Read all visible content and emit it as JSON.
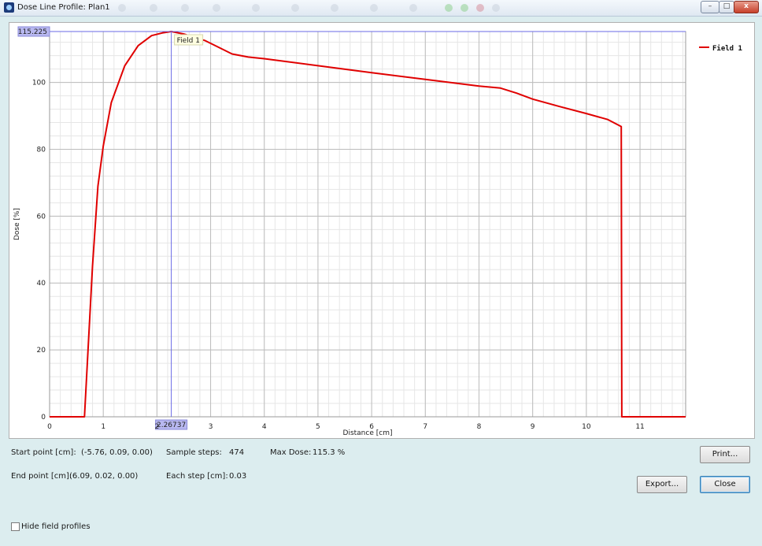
{
  "window": {
    "title": "Dose Line Profile: Plan1",
    "min_label": "–",
    "max_label": "□",
    "close_label": "x"
  },
  "info": {
    "start_label": "Start point [cm]:",
    "start_value": "(-5.76, 0.09, 0.00)",
    "end_label": "End point [cm]:",
    "end_value": "(6.09, 0.02, 0.00)",
    "steps_label": "Sample steps:",
    "steps_value": "474",
    "each_label": "Each step [cm]:",
    "each_value": "0.03",
    "maxdose_label": "Max Dose:",
    "maxdose_value": "115.3 %"
  },
  "buttons": {
    "print": "Print...",
    "export": "Export...",
    "close": "Close"
  },
  "hide_profiles_label": "Hide field profiles",
  "chart_data": {
    "type": "line",
    "xlabel": "Distance [cm]",
    "ylabel": "Dose [%]",
    "xlim": [
      0,
      11.85
    ],
    "ylim": [
      0,
      115.225
    ],
    "x_ticks": [
      0,
      1,
      2,
      3,
      4,
      5,
      6,
      7,
      8,
      9,
      10,
      11
    ],
    "y_ticks": [
      0,
      20,
      40,
      60,
      80,
      100
    ],
    "grid": true,
    "legend_position": "top-right",
    "cursor": {
      "x": 2.26737,
      "y": 115.225,
      "x_label": "2.26737",
      "y_label": "115.225",
      "tooltip": "Field 1"
    },
    "series": [
      {
        "name": "Field 1",
        "color": "#e00000",
        "x": [
          0,
          0.65,
          0.7,
          0.8,
          0.9,
          1.0,
          1.15,
          1.4,
          1.65,
          1.9,
          2.1,
          2.26737,
          2.5,
          2.9,
          3.1,
          3.4,
          3.7,
          4.0,
          5.0,
          6.0,
          7.0,
          8.0,
          8.4,
          8.7,
          9.0,
          9.5,
          10.0,
          10.4,
          10.65,
          10.66,
          11.85
        ],
        "y": [
          0,
          0,
          15,
          45,
          69,
          81,
          94,
          105,
          111,
          114,
          114.8,
          115.225,
          114.5,
          112.5,
          110.9,
          108.5,
          107.6,
          107.1,
          105,
          102.9,
          100.9,
          98.9,
          98.3,
          96.8,
          95,
          92.8,
          90.7,
          88.9,
          86.8,
          0,
          0
        ]
      }
    ]
  }
}
